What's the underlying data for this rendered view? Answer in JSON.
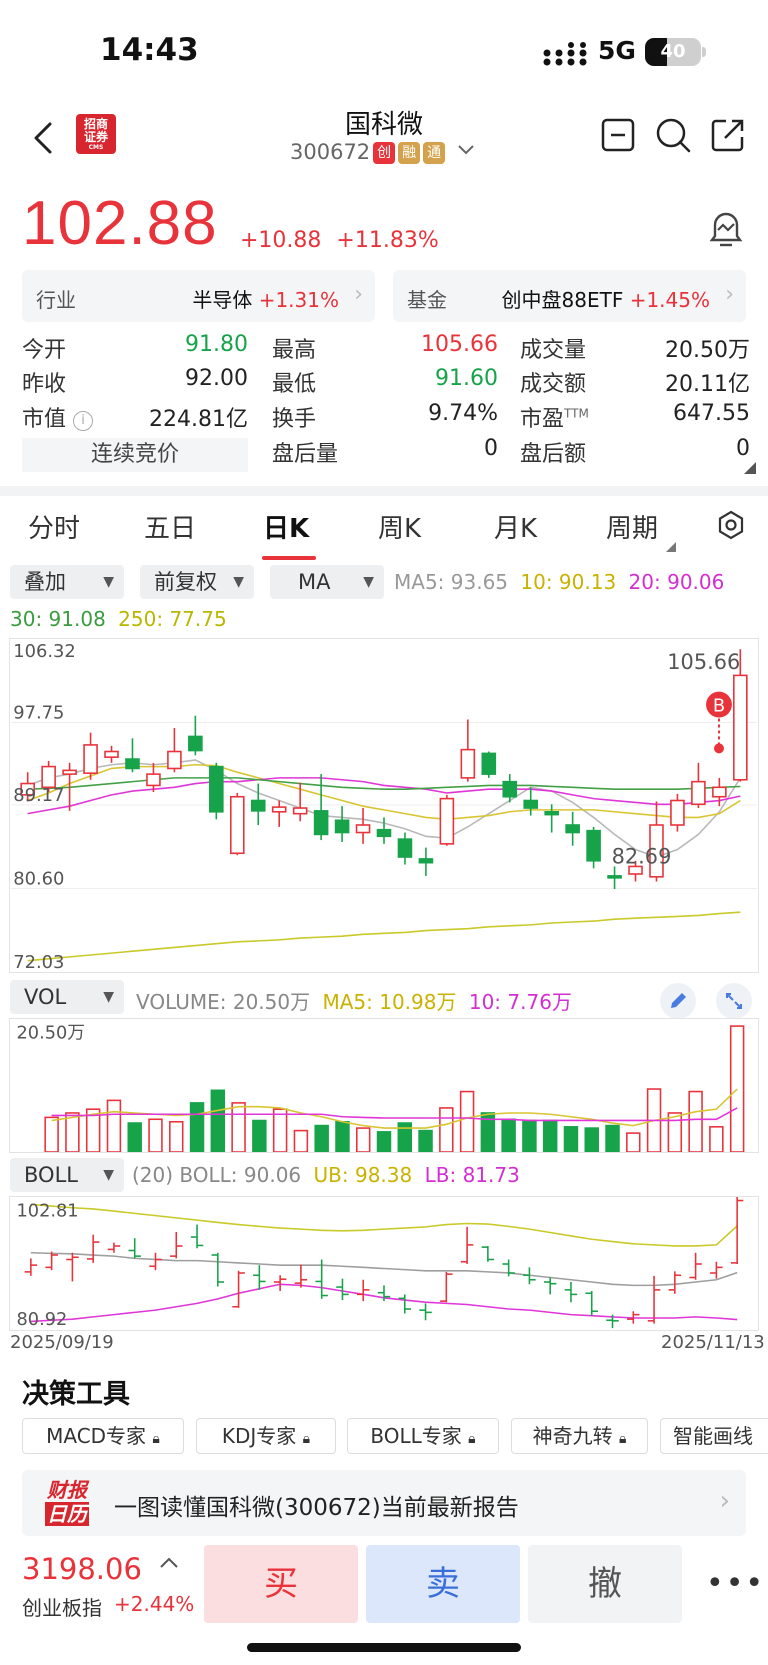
{
  "status_bar": {
    "time": "14:43",
    "network": "5G",
    "battery": "40",
    "battery_level": 0.4
  },
  "header": {
    "title": "国科微",
    "code": "300672",
    "tags": [
      {
        "label": "创",
        "color": "#e8333b"
      },
      {
        "label": "融",
        "color": "#d4a24c"
      },
      {
        "label": "通",
        "color": "#d4a24c"
      }
    ],
    "broker_logo_text": "招商证券",
    "broker_logo_sub": "CMS"
  },
  "quote": {
    "price": "102.88",
    "change": "+10.88",
    "change_pct": "+11.83%"
  },
  "industry": {
    "label": "行业",
    "name": "半导体",
    "pct": "+1.31%"
  },
  "fund": {
    "label": "基金",
    "name": "创中盘88ETF",
    "pct": "+1.45%"
  },
  "stats": {
    "open_k": "今开",
    "open_v": "91.80",
    "high_k": "最高",
    "high_v": "105.66",
    "volume_k": "成交量",
    "volume_v": "20.50万",
    "prev_k": "昨收",
    "prev_v": "92.00",
    "low_k": "最低",
    "low_v": "91.60",
    "amount_k": "成交额",
    "amount_v": "20.11亿",
    "mcap_k": "市值",
    "mcap_v": "224.81亿",
    "turnover_k": "换手",
    "turnover_v": "9.74%",
    "pe_k": "市盈",
    "pe_sup": "TTM",
    "pe_v": "647.55",
    "auction": "连续竞价",
    "after_vol_k": "盘后量",
    "after_vol_v": "0",
    "after_amt_k": "盘后额",
    "after_amt_v": "0"
  },
  "tabs": [
    "分时",
    "五日",
    "日K",
    "周K",
    "月K",
    "周期"
  ],
  "controls": {
    "overlay": "叠加",
    "adjust": "前复权",
    "indicator": "MA"
  },
  "ma": {
    "ma5": "MA5: 93.65",
    "ma10": "10: 90.13",
    "ma20": "20: 90.06",
    "ma30": "30: 91.08",
    "ma250": "250: 77.75"
  },
  "kline": {
    "y_labels": [
      "106.32",
      "97.75",
      "89.17",
      "80.60",
      "72.03"
    ],
    "high_mark": "105.66",
    "low_mark": "82.69",
    "buy_marker": "B"
  },
  "volume": {
    "selector": "VOL",
    "volume_text": "VOLUME: 20.50万",
    "ma5": "MA5: 10.98万",
    "ma10": "10: 7.76万",
    "y_label": "20.50万"
  },
  "boll": {
    "selector": "BOLL",
    "text": "(20) BOLL: 90.06",
    "ub": "UB: 98.38",
    "lb": "LB: 81.73",
    "y_top": "102.81",
    "y_bottom": "80.92"
  },
  "dates": {
    "start": "2025/09/19",
    "end": "2025/11/13"
  },
  "tools": {
    "title": "决策工具",
    "items": [
      "MACD专家",
      "KDJ专家",
      "BOLL专家",
      "神奇九转",
      "智能画线"
    ]
  },
  "report": {
    "icon_top": "财报",
    "icon_bottom": "日历",
    "text": "一图读懂国科微(300672)当前最新报告"
  },
  "index": {
    "value": "3198.06",
    "name": "创业板指",
    "pct": "+2.44%"
  },
  "actions": {
    "buy": "买",
    "sell": "卖",
    "cancel": "撤"
  },
  "chart_data": {
    "type": "candlestick",
    "title": "",
    "ylim": [
      72.03,
      106.32
    ],
    "candles": [
      {
        "o": 90.2,
        "c": 91.4,
        "h": 92.6,
        "l": 89.5
      },
      {
        "o": 91.0,
        "c": 93.2,
        "h": 93.8,
        "l": 90.5
      },
      {
        "o": 92.4,
        "c": 92.8,
        "h": 93.6,
        "l": 88.5
      },
      {
        "o": 92.5,
        "c": 95.5,
        "h": 96.8,
        "l": 91.8
      },
      {
        "o": 94.2,
        "c": 94.8,
        "h": 95.4,
        "l": 93.6
      },
      {
        "o": 94.0,
        "c": 93.0,
        "h": 96.2,
        "l": 92.6
      },
      {
        "o": 91.2,
        "c": 92.4,
        "h": 93.6,
        "l": 90.5
      },
      {
        "o": 93.0,
        "c": 94.8,
        "h": 97.3,
        "l": 92.6
      },
      {
        "o": 96.4,
        "c": 94.9,
        "h": 98.6,
        "l": 94.4
      },
      {
        "o": 93.2,
        "c": 88.4,
        "h": 93.6,
        "l": 87.6
      },
      {
        "o": 84.0,
        "c": 90.0,
        "h": 90.4,
        "l": 83.8
      },
      {
        "o": 89.6,
        "c": 88.5,
        "h": 91.4,
        "l": 87.0
      },
      {
        "o": 88.4,
        "c": 88.9,
        "h": 89.6,
        "l": 86.8
      },
      {
        "o": 88.2,
        "c": 88.8,
        "h": 91.5,
        "l": 87.4
      },
      {
        "o": 88.5,
        "c": 86.0,
        "h": 92.4,
        "l": 85.4
      },
      {
        "o": 87.5,
        "c": 86.2,
        "h": 89.0,
        "l": 85.2
      },
      {
        "o": 86.2,
        "c": 87.0,
        "h": 88.8,
        "l": 85.0
      },
      {
        "o": 86.5,
        "c": 85.8,
        "h": 87.8,
        "l": 85.0
      },
      {
        "o": 85.5,
        "c": 83.6,
        "h": 86.2,
        "l": 82.8
      },
      {
        "o": 83.4,
        "c": 83.0,
        "h": 84.6,
        "l": 81.6
      },
      {
        "o": 85.0,
        "c": 89.8,
        "h": 90.2,
        "l": 84.8
      },
      {
        "o": 92.0,
        "c": 95.0,
        "h": 98.2,
        "l": 91.6
      },
      {
        "o": 94.6,
        "c": 92.4,
        "h": 94.8,
        "l": 92.0
      },
      {
        "o": 91.6,
        "c": 90.0,
        "h": 92.4,
        "l": 89.4
      },
      {
        "o": 89.6,
        "c": 88.8,
        "h": 91.0,
        "l": 88.0
      },
      {
        "o": 88.4,
        "c": 88.1,
        "h": 89.2,
        "l": 86.2
      },
      {
        "o": 87.0,
        "c": 86.2,
        "h": 88.4,
        "l": 84.8
      },
      {
        "o": 86.4,
        "c": 83.2,
        "h": 86.8,
        "l": 82.4
      },
      {
        "o": 81.6,
        "c": 81.5,
        "h": 82.6,
        "l": 80.2
      },
      {
        "o": 81.8,
        "c": 82.6,
        "h": 83.2,
        "l": 81.0
      },
      {
        "o": 81.5,
        "c": 87.0,
        "h": 89.5,
        "l": 81.0
      },
      {
        "o": 87.0,
        "c": 89.6,
        "h": 90.3,
        "l": 86.3
      },
      {
        "o": 89.2,
        "c": 91.6,
        "h": 93.6,
        "l": 88.8
      },
      {
        "o": 90.0,
        "c": 91.0,
        "h": 92.0,
        "l": 89.0
      },
      {
        "o": 91.8,
        "c": 102.88,
        "h": 105.66,
        "l": 91.6
      }
    ],
    "ma_series": [
      {
        "color": "#b8b8b8",
        "values": [
          91.2,
          92.0,
          92.4,
          93.0,
          93.4,
          93.6,
          93.4,
          93.6,
          93.9,
          92.8,
          91.4,
          90.4,
          89.6,
          88.8,
          88.0,
          87.8,
          87.6,
          87.2,
          86.6,
          85.8,
          85.6,
          86.8,
          88.2,
          89.6,
          91.0,
          90.6,
          89.4,
          87.8,
          86.0,
          84.4,
          83.6,
          84.4,
          86.0,
          88.4,
          92.0
        ]
      },
      {
        "color": "#d8c531",
        "values": [
          89.6,
          90.4,
          91.4,
          92.2,
          93.0,
          93.2,
          93.2,
          93.2,
          93.4,
          93.3,
          92.6,
          92.0,
          91.4,
          90.8,
          90.2,
          89.6,
          89.0,
          88.6,
          88.2,
          87.8,
          87.6,
          87.8,
          88.0,
          88.4,
          88.6,
          88.6,
          88.6,
          88.6,
          88.4,
          88.2,
          88.0,
          87.8,
          87.8,
          88.2,
          89.6
        ]
      },
      {
        "color": "#e035d8",
        "values": [
          88.2,
          88.6,
          89.0,
          89.6,
          90.2,
          90.6,
          90.8,
          91.0,
          91.4,
          91.6,
          91.6,
          91.8,
          92.0,
          92.0,
          92.0,
          91.8,
          91.6,
          91.2,
          91.0,
          90.8,
          90.4,
          90.6,
          90.8,
          90.8,
          90.8,
          90.6,
          90.2,
          89.8,
          89.6,
          89.4,
          89.2,
          89.2,
          89.4,
          89.6,
          90.06
        ]
      },
      {
        "color": "#43a047",
        "values": [
          90.8,
          90.9,
          91.0,
          91.2,
          91.4,
          91.6,
          91.8,
          92.0,
          92.0,
          92.0,
          92.0,
          91.8,
          91.6,
          91.4,
          91.2,
          91.0,
          90.9,
          90.8,
          90.8,
          90.9,
          91.0,
          91.1,
          91.2,
          91.2,
          91.2,
          91.1,
          91.0,
          90.9,
          90.8,
          90.8,
          90.8,
          90.8,
          90.9,
          91.0,
          91.08
        ]
      },
      {
        "color": "#c9c928",
        "values": [
          72.6,
          72.8,
          73.0,
          73.2,
          73.4,
          73.6,
          73.8,
          74.0,
          74.2,
          74.4,
          74.6,
          74.7,
          74.8,
          75.0,
          75.1,
          75.2,
          75.4,
          75.5,
          75.6,
          75.8,
          75.9,
          76.0,
          76.2,
          76.3,
          76.4,
          76.6,
          76.7,
          76.8,
          77.0,
          77.1,
          77.2,
          77.3,
          77.4,
          77.6,
          77.75
        ]
      }
    ],
    "volume": [
      0.55,
      0.62,
      0.68,
      0.82,
      0.46,
      0.52,
      0.48,
      0.78,
      0.98,
      0.78,
      0.5,
      0.68,
      0.34,
      0.42,
      0.48,
      0.38,
      0.32,
      0.46,
      0.34,
      0.7,
      0.96,
      0.62,
      0.52,
      0.5,
      0.5,
      0.4,
      0.38,
      0.42,
      0.3,
      1.0,
      0.62,
      0.96,
      0.4,
      2.0
    ],
    "volume_scale_max": 2.05,
    "volume_ma": [
      {
        "color": "#d8c531",
        "values": [
          0.5,
          0.55,
          0.6,
          0.64,
          0.62,
          0.6,
          0.58,
          0.6,
          0.66,
          0.72,
          0.72,
          0.7,
          0.62,
          0.56,
          0.48,
          0.42,
          0.38,
          0.38,
          0.38,
          0.44,
          0.54,
          0.6,
          0.62,
          0.62,
          0.6,
          0.56,
          0.52,
          0.46,
          0.42,
          0.5,
          0.56,
          0.64,
          0.68,
          1.0
        ]
      },
      {
        "color": "#e035d8",
        "values": [
          0.58,
          0.58,
          0.58,
          0.6,
          0.6,
          0.6,
          0.6,
          0.6,
          0.6,
          0.6,
          0.6,
          0.6,
          0.6,
          0.6,
          0.56,
          0.55,
          0.54,
          0.54,
          0.54,
          0.54,
          0.54,
          0.52,
          0.52,
          0.5,
          0.5,
          0.5,
          0.5,
          0.5,
          0.5,
          0.5,
          0.5,
          0.52,
          0.52,
          0.7
        ]
      }
    ],
    "boll_ylim": [
      80.92,
      102.81
    ],
    "boll_bands": [
      {
        "color": "#c9c928",
        "values": [
          102.2,
          101.9,
          101.6,
          101.4,
          101.0,
          100.6,
          100.2,
          99.8,
          99.4,
          99.0,
          98.6,
          98.3,
          98.0,
          97.8,
          97.6,
          97.5,
          97.6,
          97.8,
          98.0,
          98.2,
          98.6,
          98.8,
          98.7,
          98.3,
          97.8,
          97.2,
          96.6,
          96.0,
          95.6,
          95.2,
          95.0,
          94.8,
          94.8,
          95.0,
          98.38
        ]
      },
      {
        "color": "#9e9e9e",
        "values": [
          93.6,
          93.5,
          93.4,
          93.2,
          93.0,
          92.6,
          92.4,
          92.2,
          92.2,
          92.0,
          91.8,
          91.6,
          91.4,
          91.4,
          91.4,
          91.2,
          91.0,
          90.8,
          90.6,
          90.4,
          90.4,
          90.4,
          90.2,
          90.0,
          89.6,
          89.2,
          88.8,
          88.4,
          88.0,
          87.8,
          87.8,
          88.0,
          88.4,
          88.8,
          90.06
        ]
      },
      {
        "color": "#e035d8",
        "values": [
          81.4,
          81.6,
          81.8,
          82.2,
          82.6,
          83.0,
          83.4,
          84.0,
          84.6,
          85.4,
          86.4,
          87.2,
          88.0,
          87.8,
          87.4,
          86.8,
          86.2,
          85.6,
          85.2,
          84.8,
          84.6,
          84.4,
          84.0,
          83.6,
          83.4,
          83.0,
          82.6,
          82.4,
          82.2,
          82.0,
          82.0,
          82.0,
          82.2,
          82.0,
          81.73
        ]
      }
    ]
  }
}
